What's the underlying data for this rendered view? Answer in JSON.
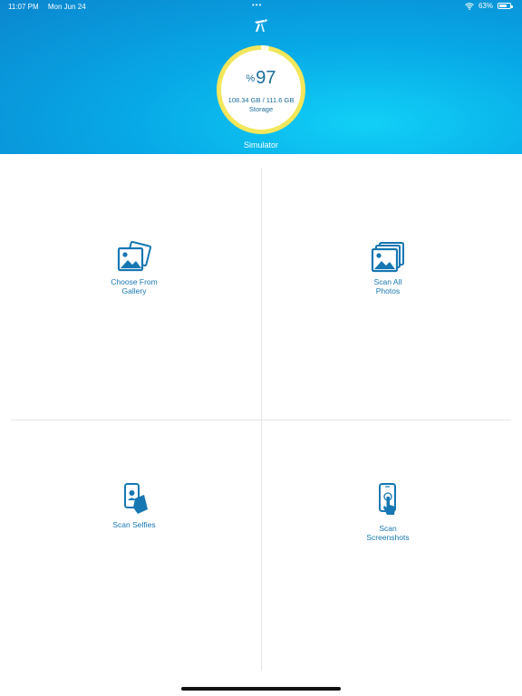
{
  "status_bar": {
    "time": "11:07 PM",
    "date": "Mon Jun 24",
    "battery": "63%",
    "battery_level": 0.63
  },
  "storage": {
    "percent_symbol": "%",
    "percent": "97",
    "used_total": "108.34 GB / 111.6 GB",
    "label": "Storage",
    "device_name": "Simulator",
    "used_fraction": 0.97
  },
  "tiles": [
    {
      "label": "Choose From Gallery",
      "line1": "Choose From",
      "line2": "Gallery",
      "icon": "gallery-icon"
    },
    {
      "label": "Scan All Photos",
      "line1": "Scan All",
      "line2": "Photos",
      "icon": "photos-stack-icon"
    },
    {
      "label": "Scan Selfies",
      "line1": "Scan Selfies",
      "line2": "",
      "icon": "selfie-icon"
    },
    {
      "label": "Scan Screenshots",
      "line1": "Scan",
      "line2": "Screenshots",
      "icon": "screenshot-icon"
    }
  ],
  "colors": {
    "header_start": "#0b86cf",
    "header_end": "#11d0f7",
    "ring": "#f3e65b",
    "accent": "#1677b3"
  }
}
